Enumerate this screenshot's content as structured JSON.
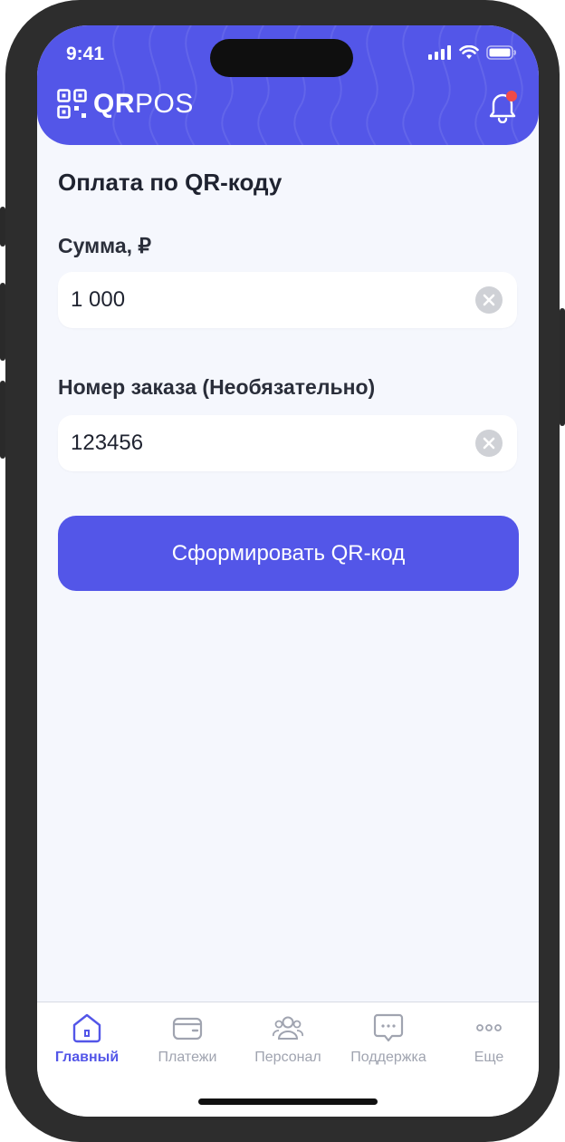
{
  "status_bar": {
    "time": "9:41"
  },
  "header": {
    "logo_bold": "QR",
    "logo_light": "POS",
    "brand_color": "#5356E8",
    "notification_dot_color": "#F04A4A"
  },
  "page": {
    "title": "Оплата по QR-коду"
  },
  "form": {
    "amount": {
      "label": "Сумма, ₽",
      "value": "1 000"
    },
    "order": {
      "label": "Номер заказа (Необязательно)",
      "value": "123456"
    },
    "submit_label": "Сформировать QR-код"
  },
  "tabs": [
    {
      "label": "Главный",
      "icon": "home-icon",
      "active": true
    },
    {
      "label": "Платежи",
      "icon": "wallet-icon",
      "active": false
    },
    {
      "label": "Персонал",
      "icon": "people-icon",
      "active": false
    },
    {
      "label": "Поддержка",
      "icon": "chat-icon",
      "active": false
    },
    {
      "label": "Еще",
      "icon": "more-icon",
      "active": false
    }
  ]
}
